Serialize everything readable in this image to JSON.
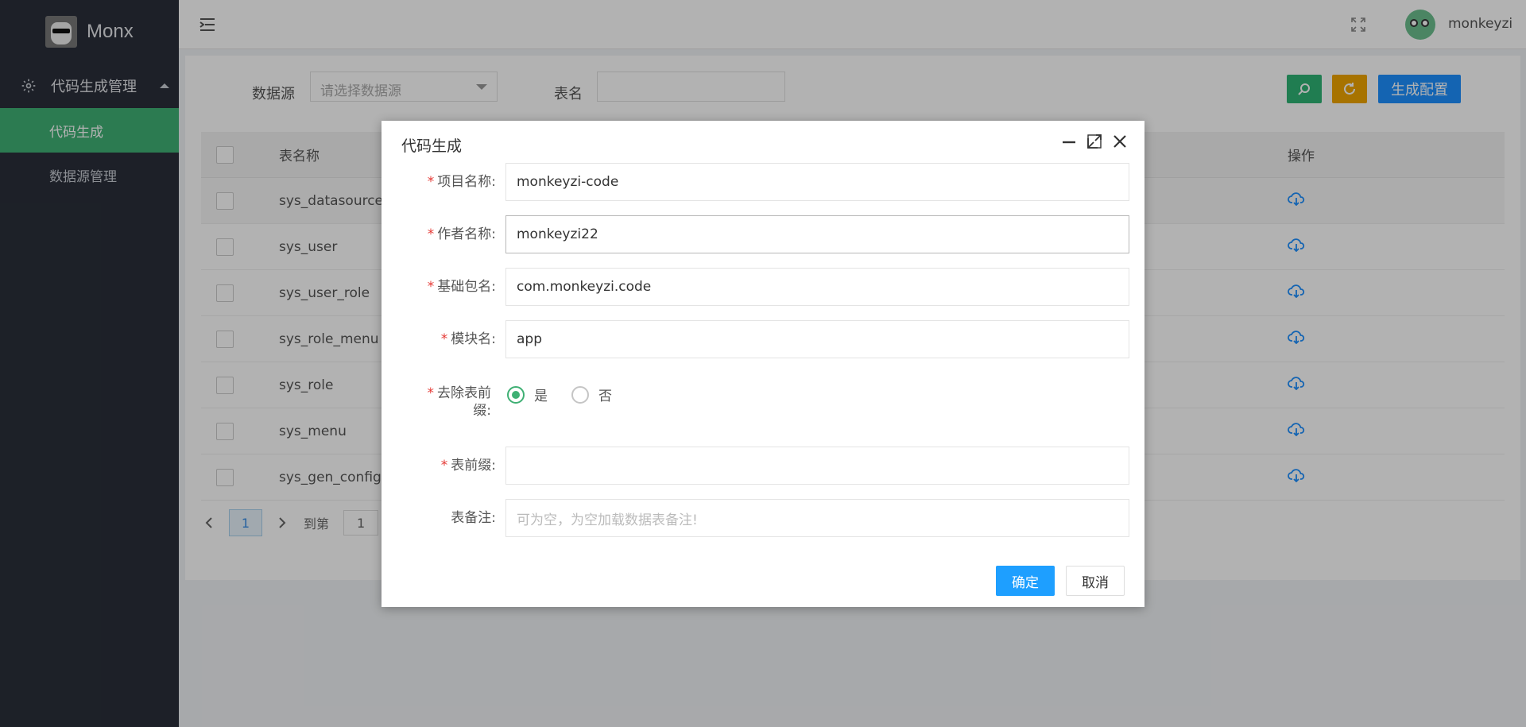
{
  "brand": {
    "name": "Monx"
  },
  "sidebar": {
    "group_label": "代码生成管理",
    "items": [
      {
        "label": "代码生成",
        "active": true
      },
      {
        "label": "数据源管理",
        "active": false
      }
    ]
  },
  "header": {
    "username": "monkeyzi"
  },
  "filters": {
    "datasource_label": "数据源",
    "datasource_placeholder": "请选择数据源",
    "table_label": "表名",
    "table_value": "",
    "generate_config_label": "生成配置"
  },
  "table": {
    "col_name": "表名称",
    "col_op": "操作",
    "rows": [
      "sys_datasource_config",
      "sys_user",
      "sys_user_role",
      "sys_role_menu",
      "sys_role",
      "sys_menu",
      "sys_gen_config"
    ]
  },
  "pager": {
    "current": "1",
    "goto_label": "到第",
    "goto_value": "1"
  },
  "dialog": {
    "title": "代码生成",
    "fields": {
      "project_label": "项目名称:",
      "project_value": "monkeyzi-code",
      "author_label": "作者名称:",
      "author_value": "monkeyzi22",
      "package_label": "基础包名:",
      "package_value": "com.monkeyzi.code",
      "module_label": "模块名:",
      "module_value": "app",
      "prefix_remove_label_1": "去除表前",
      "prefix_remove_label_2": "缀:",
      "prefix_yes": "是",
      "prefix_no": "否",
      "prefix_selected": "是",
      "table_prefix_label": "表前缀:",
      "table_prefix_value": "",
      "table_comment_label": "表备注:",
      "table_comment_placeholder": "可为空，为空加载数据表备注!"
    },
    "confirm_label": "确定",
    "cancel_label": "取消"
  },
  "colors": {
    "sidebar_bg": "#2a2f3a",
    "accent_green": "#3fb074",
    "search_green": "#2fb474",
    "refresh_orange": "#f0a500",
    "primary_blue": "#1e90ff",
    "confirm_blue": "#1e9fff"
  }
}
